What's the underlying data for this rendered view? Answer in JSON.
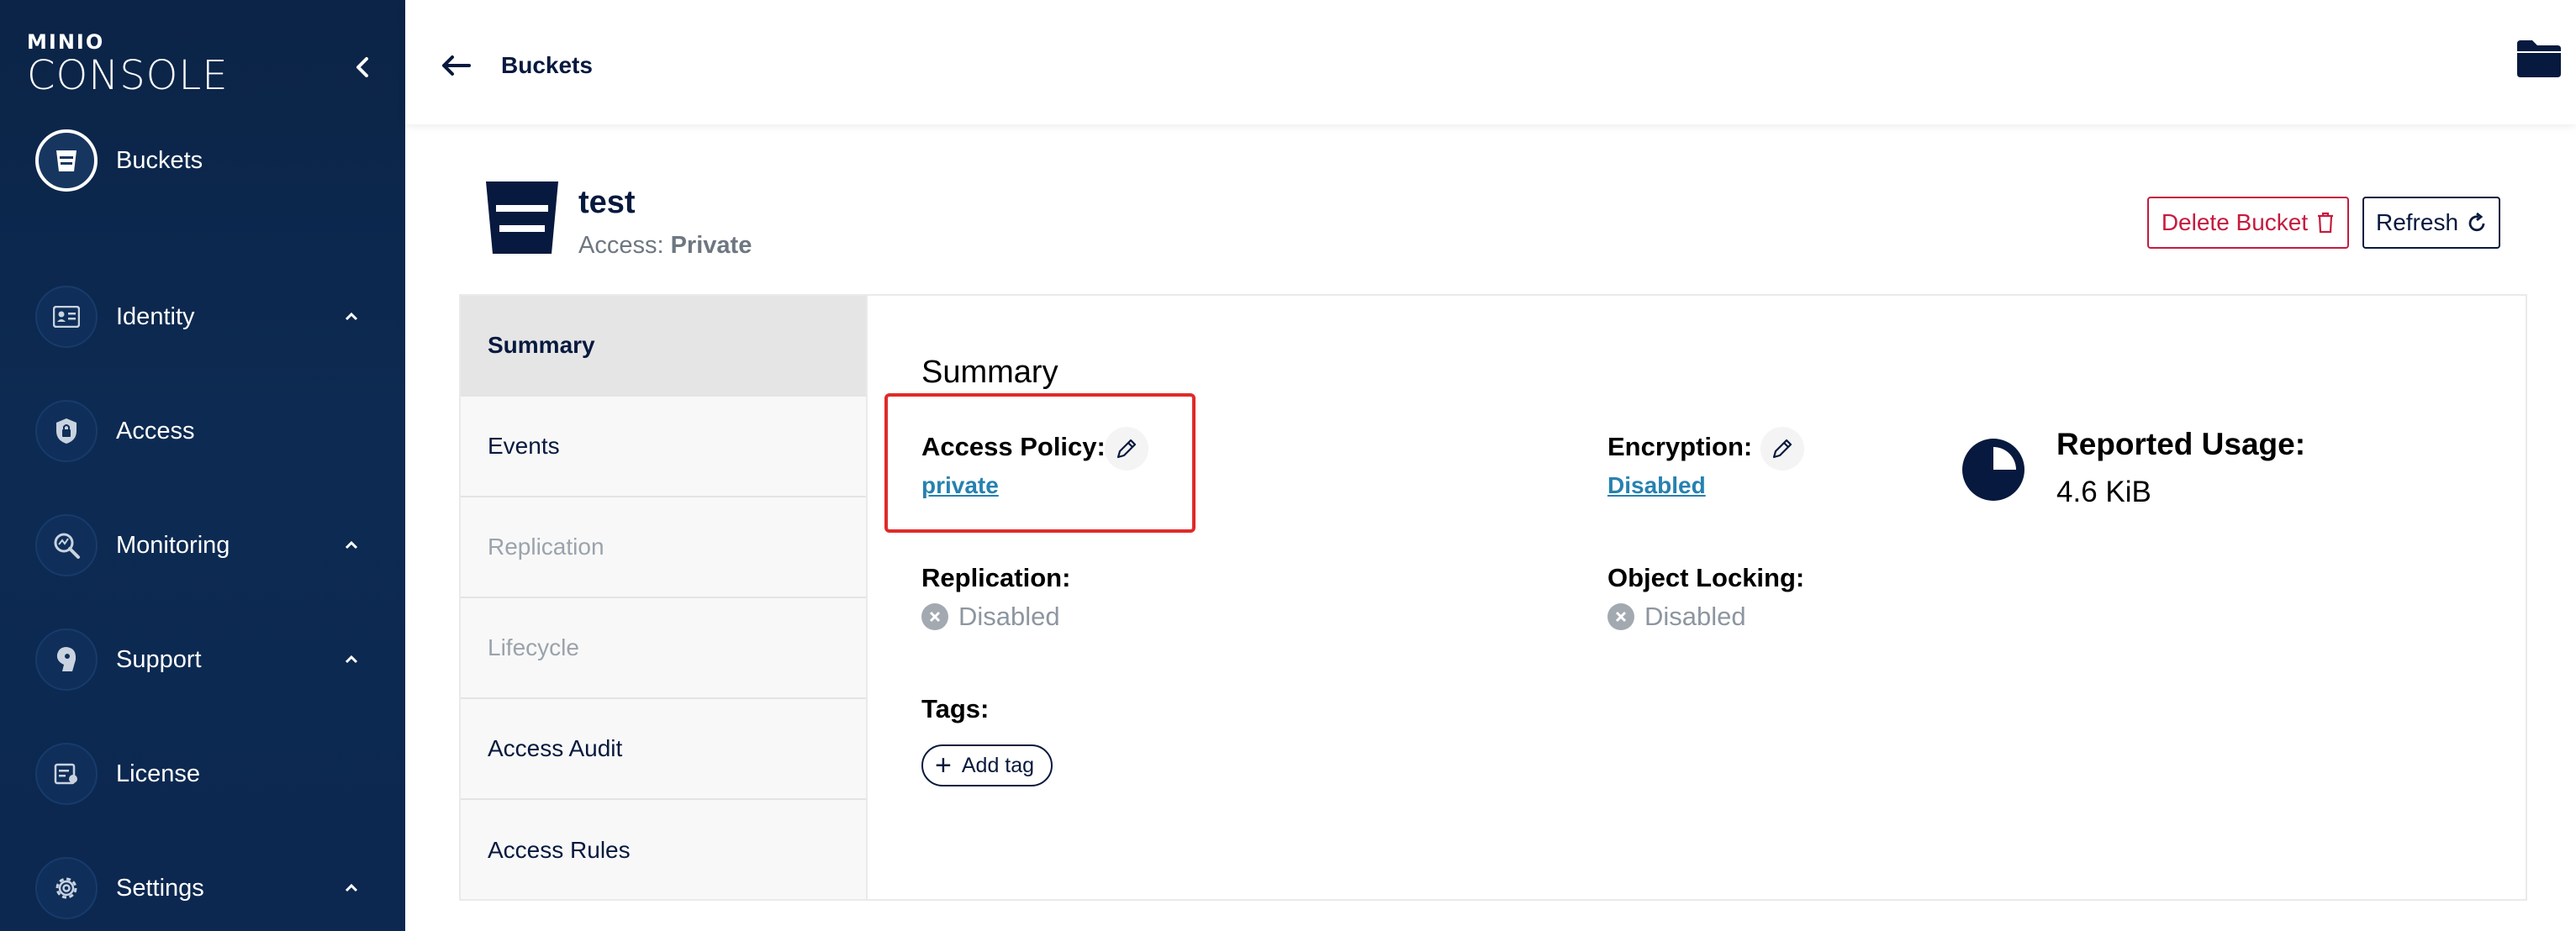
{
  "sidebar": {
    "logo_small": "MINIO",
    "logo_big": "CONSOLE",
    "items": [
      {
        "label": "Buckets",
        "icon": "bucket-icon",
        "active": true
      },
      {
        "label": "Identity",
        "icon": "id-card-icon",
        "expandable": true
      },
      {
        "label": "Access",
        "icon": "lock-shield-icon"
      },
      {
        "label": "Monitoring",
        "icon": "magnifier-chart-icon",
        "expandable": true
      },
      {
        "label": "Support",
        "icon": "support-icon",
        "expandable": true
      },
      {
        "label": "License",
        "icon": "license-icon"
      },
      {
        "label": "Settings",
        "icon": "gear-icon",
        "expandable": true
      }
    ]
  },
  "header": {
    "breadcrumb": "Buckets"
  },
  "bucket": {
    "name": "test",
    "access_label": "Access:",
    "access_value": "Private",
    "delete_label": "Delete Bucket",
    "refresh_label": "Refresh"
  },
  "tabs": [
    {
      "label": "Summary",
      "state": "active"
    },
    {
      "label": "Events",
      "state": "normal"
    },
    {
      "label": "Replication",
      "state": "disabled"
    },
    {
      "label": "Lifecycle",
      "state": "disabled"
    },
    {
      "label": "Access Audit",
      "state": "normal"
    },
    {
      "label": "Access Rules",
      "state": "normal"
    }
  ],
  "summary": {
    "title": "Summary",
    "access_policy_label": "Access Policy:",
    "access_policy_value": "private",
    "encryption_label": "Encryption:",
    "encryption_value": "Disabled",
    "reported_usage_label": "Reported Usage:",
    "reported_usage_value": "4.6 KiB",
    "replication_label": "Replication:",
    "replication_value": "Disabled",
    "object_locking_label": "Object Locking:",
    "object_locking_value": "Disabled",
    "tags_label": "Tags:",
    "add_tag_label": "Add tag"
  },
  "colors": {
    "sidebar_bg": "#0b2447",
    "primary": "#07193e",
    "danger": "#c51b3f",
    "link": "#2781b0",
    "highlight": "#e02a2a"
  }
}
